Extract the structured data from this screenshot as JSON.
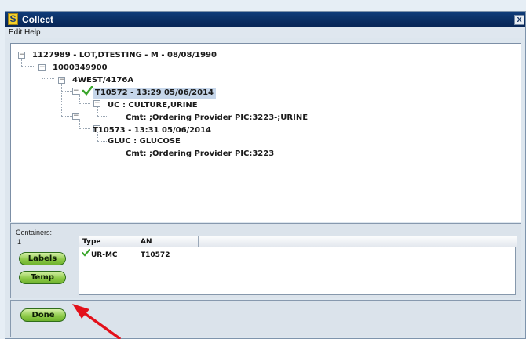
{
  "window": {
    "title": "Collect",
    "app_icon_letter": "S",
    "close_glyph": "x"
  },
  "menu": [
    {
      "label": "Edit"
    },
    {
      "label": "Help"
    }
  ],
  "tree": {
    "nodes": [
      {
        "text": "1127989 - LOT,DTESTING - M - 08/08/1990"
      },
      {
        "text": "1000349900"
      },
      {
        "text": "4WEST/4176A"
      },
      {
        "text": "T10572 - 13:29 05/06/2014",
        "selected": true,
        "checked": true
      },
      {
        "text": "UC : CULTURE,URINE"
      },
      {
        "text": "Cmt: ;Ordering Provider PIC:3223-;URINE"
      },
      {
        "text": "T10573 - 13:31 05/06/2014"
      },
      {
        "text": "GLUC : GLUCOSE"
      },
      {
        "text": "Cmt: ;Ordering Provider PIC:3223"
      }
    ],
    "expander_glyph": "−"
  },
  "containers": {
    "label": "Containers:",
    "count": "1",
    "labels_button": "Labels",
    "temp_button": "Temp",
    "table": {
      "columns": [
        "Type",
        "AN"
      ],
      "rows": [
        {
          "type": "UR-MC",
          "an": "T10572",
          "checked": true
        }
      ]
    }
  },
  "done_button": "Done",
  "annotation": {
    "arrow_color": "#e3101a"
  },
  "colors": {
    "title_bar": "#0a2d61",
    "button_green": "#8fcb4a",
    "selection": "#c6d6ea",
    "check_green": "#3aa52b"
  }
}
